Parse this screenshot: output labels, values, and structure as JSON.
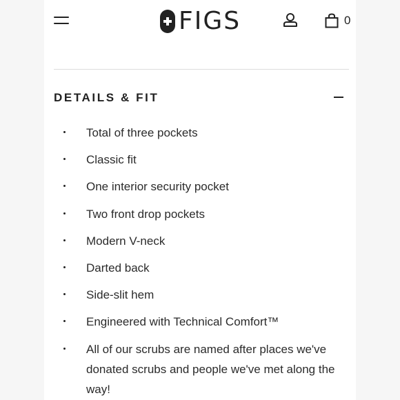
{
  "header": {
    "brand": "FIGS",
    "cart_count": "0"
  },
  "section": {
    "title": "DETAILS & FIT",
    "items": [
      "Total of three pockets",
      "Classic fit",
      "One interior security pocket",
      "Two front drop pockets",
      "Modern V-neck",
      "Darted back",
      "Side-slit hem",
      "Engineered with Technical Comfort™",
      "All of our scrubs are named after places we've donated scrubs and people we've met along the way!"
    ]
  },
  "icons": {
    "menu": "hamburger-menu-icon",
    "logo": "figs-logo-icon",
    "account": "user-icon",
    "cart": "shopping-bag-icon",
    "collapse": "minus-icon"
  }
}
